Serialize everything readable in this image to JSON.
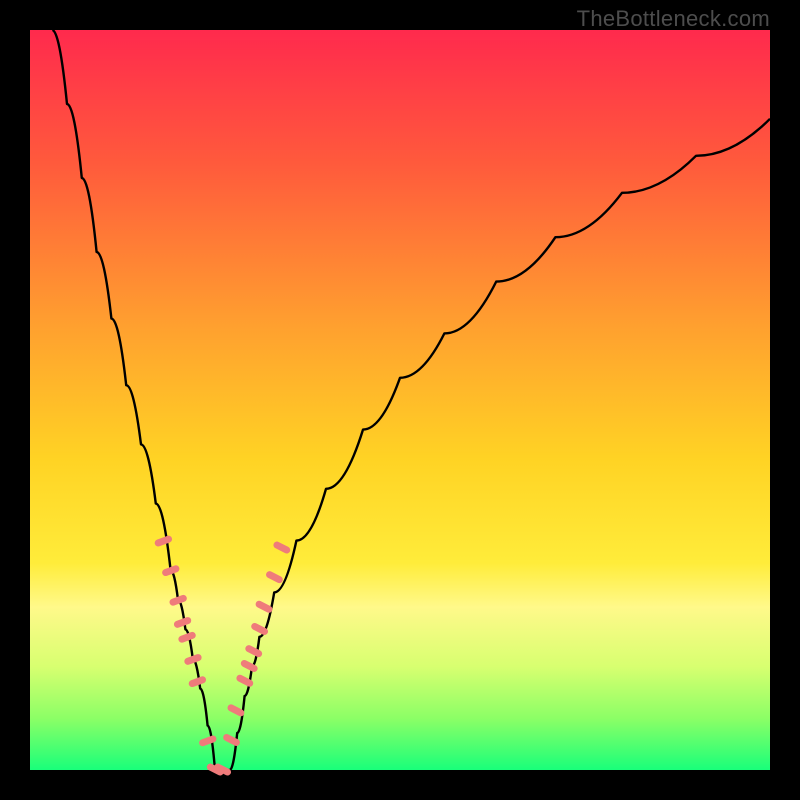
{
  "watermark": {
    "text": "TheBottleneck.com"
  },
  "gradient": {
    "stops": [
      {
        "pct": 0,
        "color": "#ff2a4d"
      },
      {
        "pct": 18,
        "color": "#ff5a3c"
      },
      {
        "pct": 40,
        "color": "#ffa02f"
      },
      {
        "pct": 58,
        "color": "#ffd324"
      },
      {
        "pct": 72,
        "color": "#ffec3a"
      },
      {
        "pct": 78,
        "color": "#fff98a"
      },
      {
        "pct": 86,
        "color": "#d8ff70"
      },
      {
        "pct": 93,
        "color": "#8cff66"
      },
      {
        "pct": 100,
        "color": "#19ff7a"
      }
    ]
  },
  "chart_data": {
    "type": "line",
    "title": "",
    "xlabel": "",
    "ylabel": "",
    "xlim": [
      0,
      100
    ],
    "ylim": [
      0,
      100
    ],
    "note": "V-shaped bottleneck curve. Minimum (zero bottleneck) at x≈25. Left branch rises steeply toward 100 as x→0; right branch rises more gradually toward ~88 as x→100. Pink segments highlight points near the trough.",
    "series": [
      {
        "name": "bottleneck-curve",
        "color": "#000000",
        "x": [
          3,
          5,
          7,
          9,
          11,
          13,
          15,
          17,
          19,
          20,
          21,
          22,
          23,
          24,
          25,
          26,
          27,
          28,
          29,
          30,
          31,
          33,
          36,
          40,
          45,
          50,
          56,
          63,
          71,
          80,
          90,
          100
        ],
        "values": [
          100,
          90,
          80,
          70,
          61,
          52,
          44,
          36,
          27,
          23,
          19,
          15,
          11,
          6,
          0,
          0,
          0,
          5,
          10,
          14,
          18,
          24,
          31,
          38,
          46,
          53,
          59,
          66,
          72,
          78,
          83,
          88
        ]
      },
      {
        "name": "highlight-dots",
        "color": "#ef7b7b",
        "x": [
          18,
          19,
          20,
          20.6,
          21.2,
          22,
          22.6,
          24,
          25,
          26,
          27.2,
          27.8,
          29,
          29.6,
          30.2,
          31,
          31.6,
          33,
          34
        ],
        "values": [
          31,
          27,
          23,
          20,
          18,
          15,
          12,
          4,
          0,
          0,
          4,
          8,
          12,
          14,
          16,
          19,
          22,
          26,
          30
        ]
      }
    ]
  }
}
